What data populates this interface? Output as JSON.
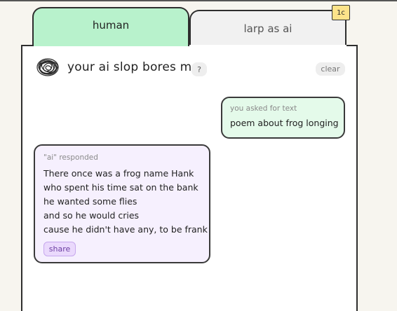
{
  "tabs": [
    {
      "label": "human",
      "active": true
    },
    {
      "label": "larp as ai",
      "active": false
    }
  ],
  "badge": "1c",
  "header": {
    "title": "your ai slop bores me",
    "help_label": "?",
    "clear_label": "clear",
    "logo_icon": "scribble-logo-icon"
  },
  "user_message": {
    "label": "you asked for text",
    "text": "poem about frog longing"
  },
  "ai_message": {
    "label": "\"ai\" responded",
    "lines": [
      "There once was a frog name Hank",
      "who spent his time sat on the bank",
      "he wanted some flies",
      "and so he would cries",
      "cause he didn't have any, to be frank"
    ],
    "share_label": "share"
  },
  "colors": {
    "human_tab": "#b8f2cc",
    "user_bubble": "#e4faea",
    "ai_bubble": "#f6f0fe",
    "badge": "#fce38a",
    "share": "#ead9fc"
  }
}
